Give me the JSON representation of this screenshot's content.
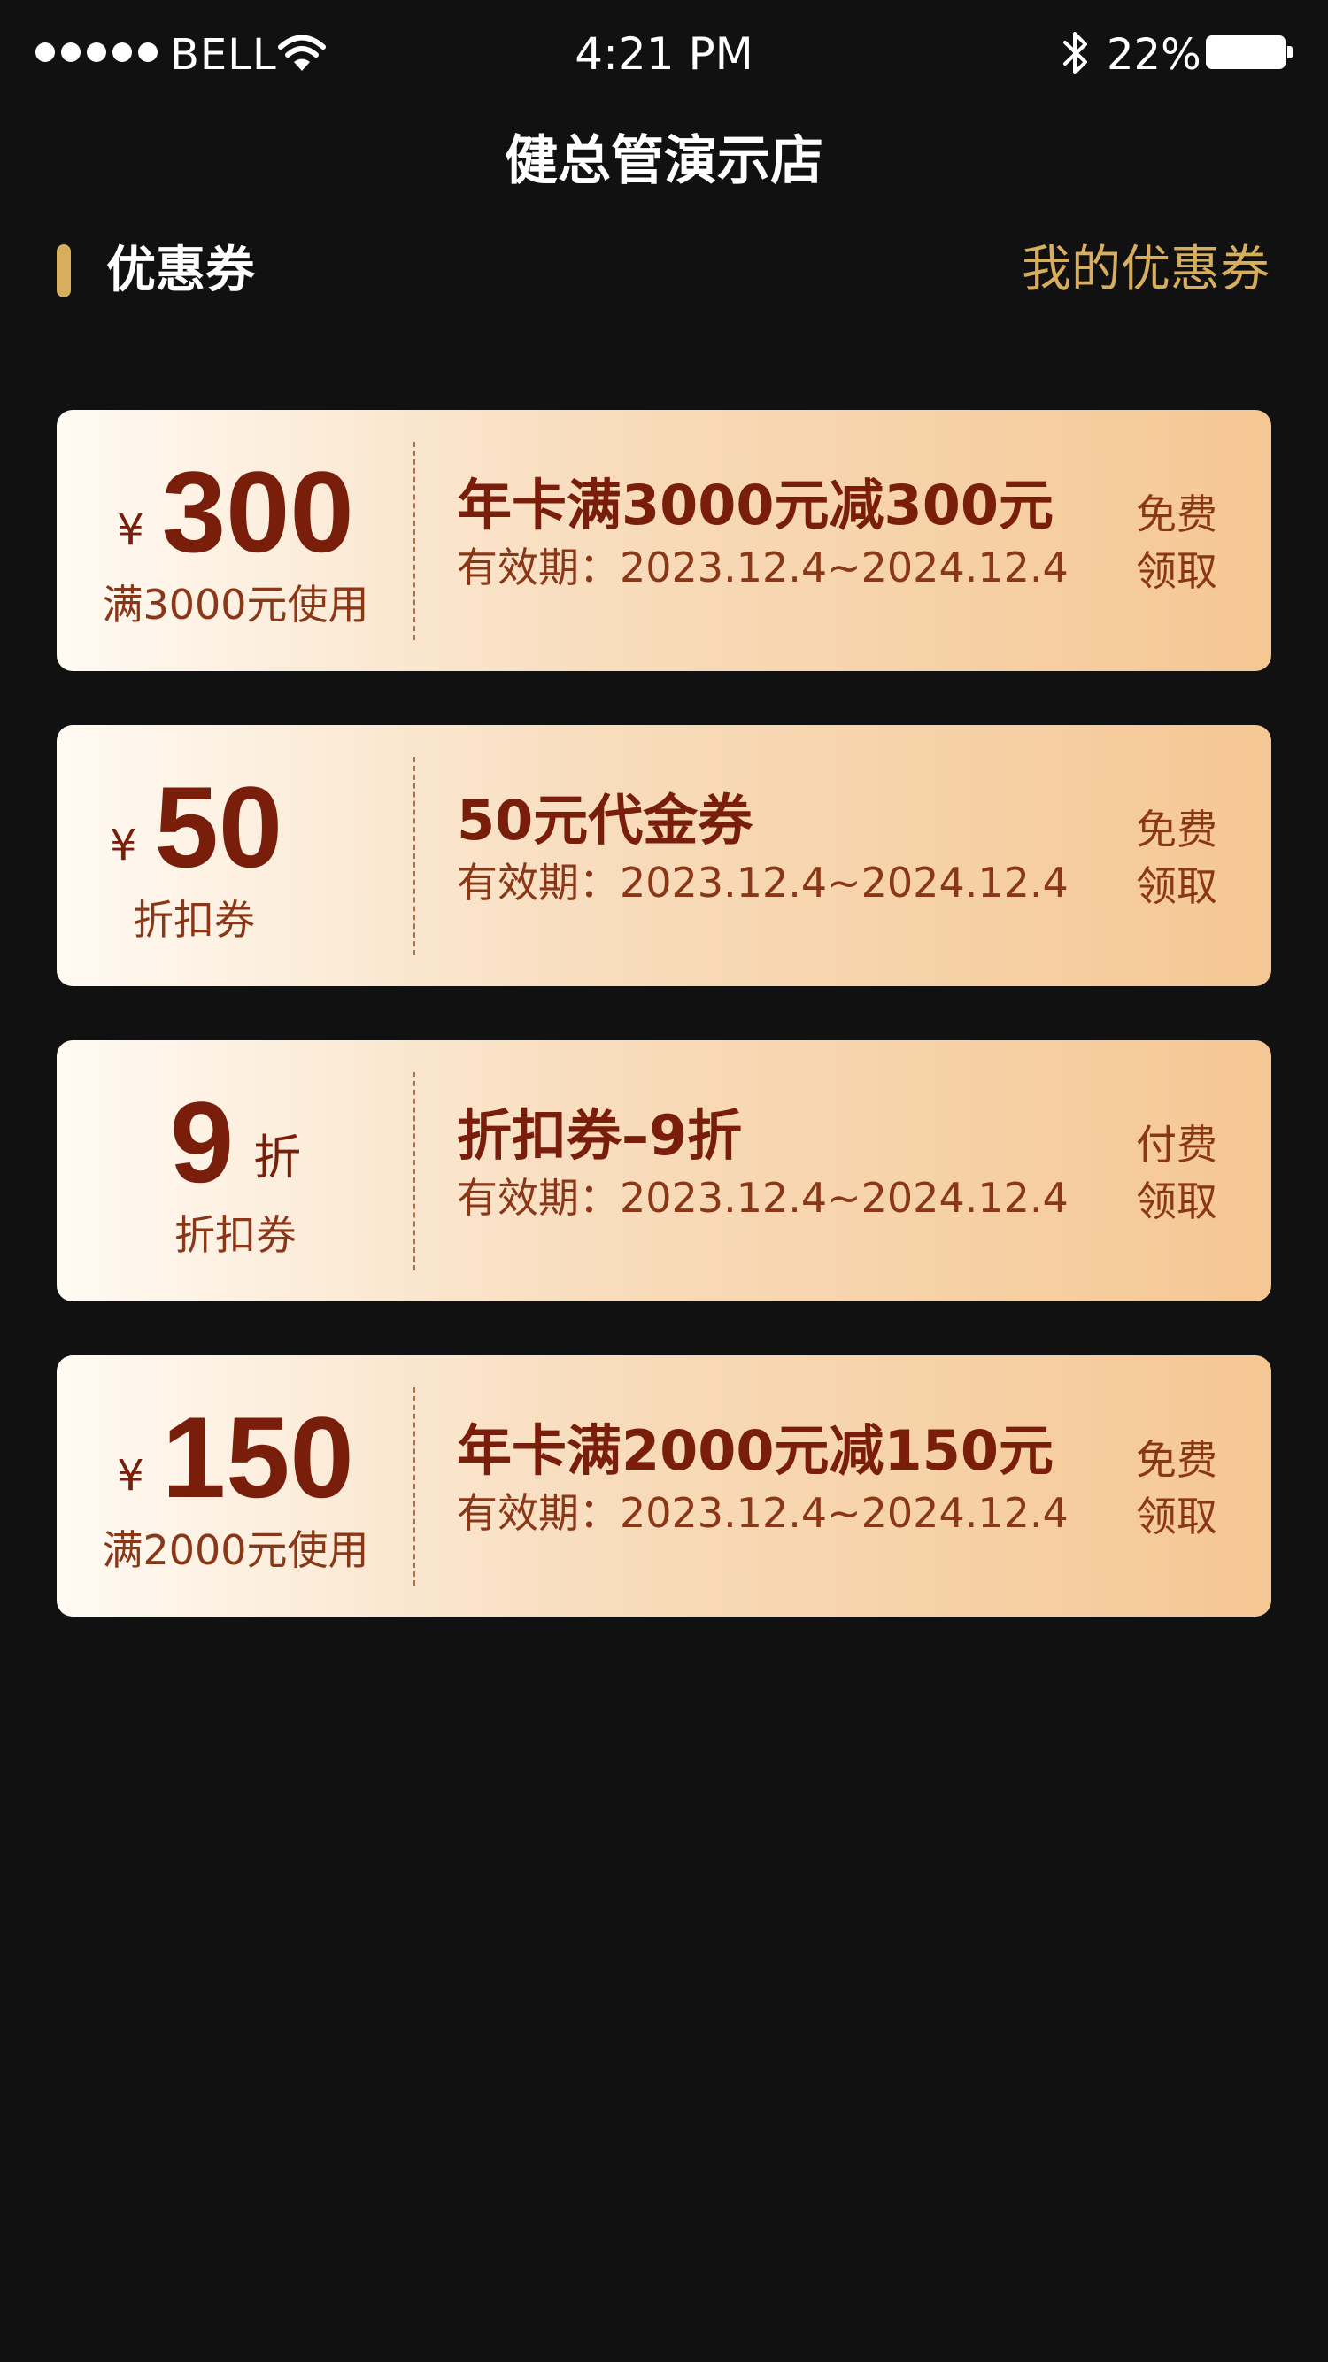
{
  "status_bar": {
    "carrier": "BELL",
    "time": "4:21 PM",
    "battery_percent": "22%",
    "signal_bars": 5,
    "icons": [
      "signal-dots-icon",
      "wifi-icon",
      "bluetooth-icon",
      "battery-icon"
    ]
  },
  "header": {
    "title": "健总管演示店"
  },
  "section": {
    "title": "优惠券",
    "link": "我的优惠券",
    "accent_color": "#d7ad5e"
  },
  "coupons": [
    {
      "currency": "¥",
      "amount": "300",
      "unit": "",
      "sub_label": "满3000元使用",
      "title": "年卡满3000元减300元",
      "validity": "有效期：2023.12.4~2024.12.4",
      "action_line1": "免费",
      "action_line2": "领取"
    },
    {
      "currency": "¥",
      "amount": "50",
      "unit": "",
      "sub_label": "折扣券",
      "title": "50元代金券",
      "validity": "有效期：2023.12.4~2024.12.4",
      "action_line1": "免费",
      "action_line2": "领取"
    },
    {
      "currency": "",
      "amount": "9",
      "unit": "折",
      "sub_label": "折扣券",
      "title": "折扣券–9折",
      "validity": "有效期：2023.12.4~2024.12.4",
      "action_line1": "付费",
      "action_line2": "领取"
    },
    {
      "currency": "¥",
      "amount": "150",
      "unit": "",
      "sub_label": "满2000元使用",
      "title": "年卡满2000元减150元",
      "validity": "有效期：2023.12.4~2024.12.4",
      "action_line1": "免费",
      "action_line2": "领取"
    }
  ],
  "colors": {
    "background": "#111112",
    "coupon_text": "#7a1e0c",
    "coupon_gradient_start": "#fffaf3",
    "coupon_gradient_end": "#f5c793"
  }
}
